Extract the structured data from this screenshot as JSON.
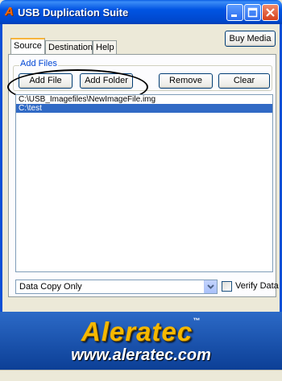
{
  "window": {
    "title": "USB Duplication Suite",
    "icon": "aleratec-a-icon",
    "icon_glyph": "A"
  },
  "toolbar": {
    "buy_media_label": "Buy Media"
  },
  "tabs": [
    {
      "label": "Source",
      "active": true
    },
    {
      "label": "Destination",
      "active": false
    },
    {
      "label": "Help",
      "active": false
    }
  ],
  "add_files": {
    "group_label": "Add Files",
    "add_file_label": "Add File",
    "add_folder_label": "Add Folder",
    "remove_label": "Remove",
    "clear_label": "Clear"
  },
  "file_list": {
    "items": [
      {
        "text": "C:\\USB_Imagefiles\\NewImageFile.img",
        "selected": false
      },
      {
        "text": "C:\\test",
        "selected": true
      }
    ]
  },
  "options": {
    "copy_mode_value": "Data Copy Only",
    "verify_label": "Verify Data",
    "verify_checked": false
  },
  "banner": {
    "brand_name": "Aleratec",
    "trademark": "™",
    "url": "www.aleratec.com",
    "brand_color": "#f5b800",
    "background_color": "#1a54b0"
  },
  "colors": {
    "titlebar": "#0054e3",
    "selection": "#316ac5",
    "group_label": "#0046d5"
  }
}
